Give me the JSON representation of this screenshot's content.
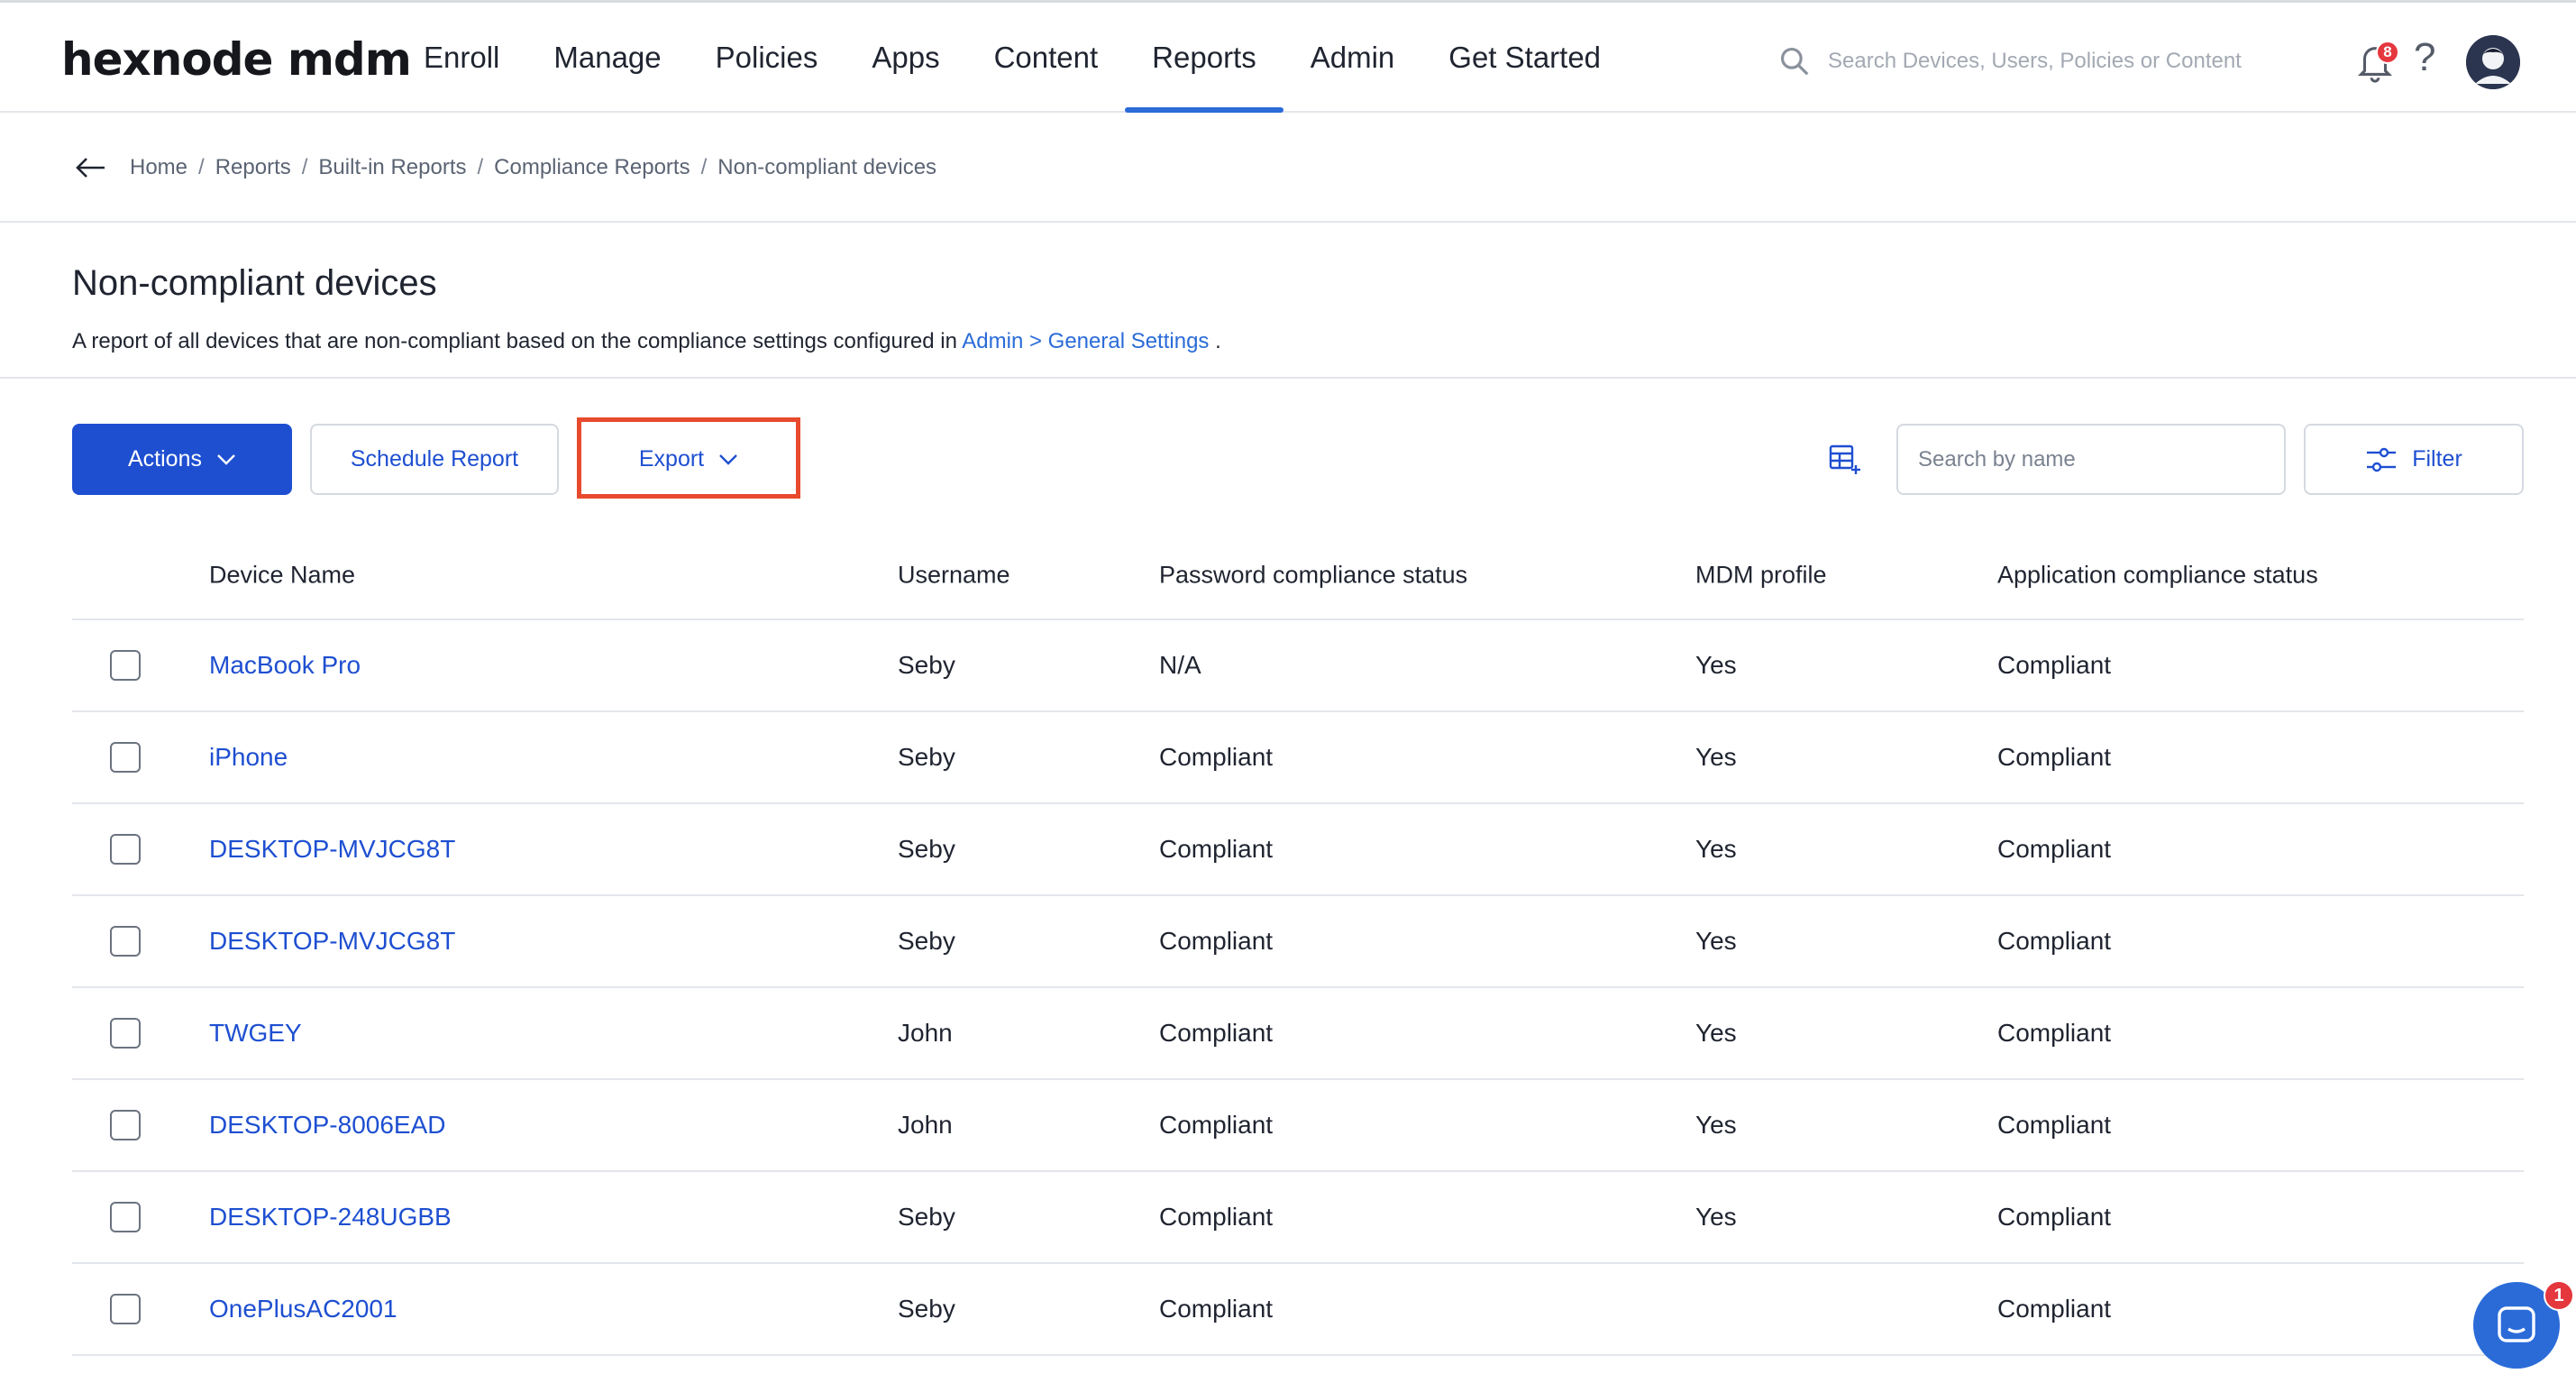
{
  "app": {
    "logo": "hexnode mdm"
  },
  "nav": {
    "items": [
      {
        "label": "Enroll"
      },
      {
        "label": "Manage"
      },
      {
        "label": "Policies"
      },
      {
        "label": "Apps"
      },
      {
        "label": "Content"
      },
      {
        "label": "Reports",
        "active": true
      },
      {
        "label": "Admin"
      },
      {
        "label": "Get Started"
      }
    ]
  },
  "topbar": {
    "search_placeholder": "Search Devices, Users, Policies or Content",
    "notification_count": "8",
    "help_symbol": "?"
  },
  "breadcrumb": {
    "items": [
      "Home",
      "Reports",
      "Built-in Reports",
      "Compliance Reports",
      "Non-compliant devices"
    ],
    "separator": "/"
  },
  "header": {
    "title": "Non-compliant devices",
    "description_prefix": "A report of all devices that are non-compliant based on the compliance settings configured in ",
    "description_link": "Admin > General Settings",
    "description_suffix": " ."
  },
  "toolbar": {
    "actions_label": "Actions",
    "schedule_label": "Schedule Report",
    "export_label": "Export",
    "search_placeholder": "Search by name",
    "filter_label": "Filter"
  },
  "table": {
    "columns": [
      "Device Name",
      "Username",
      "Password compliance status",
      "MDM profile",
      "Application compliance status"
    ],
    "rows": [
      {
        "device": "MacBook Pro",
        "user": "Seby",
        "password": "N/A",
        "mdm": "Yes",
        "app": "Compliant"
      },
      {
        "device": "iPhone",
        "user": "Seby",
        "password": "Compliant",
        "mdm": "Yes",
        "app": "Compliant"
      },
      {
        "device": "DESKTOP-MVJCG8T",
        "user": "Seby",
        "password": "Compliant",
        "mdm": "Yes",
        "app": "Compliant"
      },
      {
        "device": "DESKTOP-MVJCG8T",
        "user": "Seby",
        "password": "Compliant",
        "mdm": "Yes",
        "app": "Compliant"
      },
      {
        "device": "TWGEY",
        "user": "John",
        "password": "Compliant",
        "mdm": "Yes",
        "app": "Compliant"
      },
      {
        "device": "DESKTOP-8006EAD",
        "user": "John",
        "password": "Compliant",
        "mdm": "Yes",
        "app": "Compliant"
      },
      {
        "device": "DESKTOP-248UGBB",
        "user": "Seby",
        "password": "Compliant",
        "mdm": "Yes",
        "app": "Compliant"
      },
      {
        "device": "OnePlusAC2001",
        "user": "Seby",
        "password": "Compliant",
        "mdm": "",
        "app": "Compliant"
      }
    ]
  },
  "chat": {
    "badge_count": "1"
  },
  "colors": {
    "primary": "#1e4fd1",
    "link": "#2a6bd8",
    "highlight": "#e84a2e",
    "badge": "#e5373e"
  }
}
